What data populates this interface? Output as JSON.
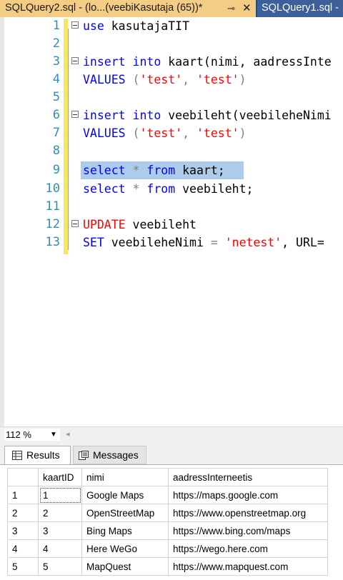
{
  "tabs": {
    "active_label": "SQLQuery2.sql - (lo...(veebiKasutaja (65))*",
    "inactive_label": "SQLQuery1.sql -"
  },
  "editor": {
    "lines": [
      {
        "n": "1",
        "fold": true
      },
      {
        "n": "2",
        "fold": false
      },
      {
        "n": "3",
        "fold": true
      },
      {
        "n": "4",
        "fold": false
      },
      {
        "n": "5",
        "fold": false
      },
      {
        "n": "6",
        "fold": true
      },
      {
        "n": "7",
        "fold": false
      },
      {
        "n": "8",
        "fold": false
      },
      {
        "n": "9",
        "fold": false
      },
      {
        "n": "10",
        "fold": false
      },
      {
        "n": "11",
        "fold": false
      },
      {
        "n": "12",
        "fold": true
      },
      {
        "n": "13",
        "fold": false
      }
    ],
    "code": {
      "l1_kw": "use",
      "l1_rest": " kasutajaTIT",
      "l3_kw1": "insert",
      "l3_kw2": "into",
      "l3_rest": " kaart(nimi, aadressInte",
      "l4_kw": "VALUES",
      "l4_p1": " (",
      "l4_s1": "'test'",
      "l4_c": ", ",
      "l4_s2": "'test'",
      "l4_p2": ")",
      "l6_kw1": "insert",
      "l6_kw2": "into",
      "l6_rest": " veebileht(veebileheNimi",
      "l7_kw": "VALUES",
      "l7_p1": " (",
      "l7_s1": "'test'",
      "l7_c": ", ",
      "l7_s2": "'test'",
      "l7_p2": ")",
      "l9_kw1": "select",
      "l9_star": " * ",
      "l9_kw2": "from",
      "l9_rest": " kaart;",
      "l10_kw1": "select",
      "l10_star": " * ",
      "l10_kw2": "from",
      "l10_rest": " veebileht;",
      "l12_kw": "UPDATE",
      "l12_rest": " veebileht",
      "l13_kw": "SET",
      "l13_rest": " veebileheNimi ",
      "l13_eq": "=",
      "l13_str": " 'netest'",
      "l13_tail": ", URL="
    }
  },
  "zoom": {
    "value": "112 %"
  },
  "results": {
    "tab_results": "Results",
    "tab_messages": "Messages",
    "columns": [
      "",
      "kaartID",
      "nimi",
      "aadressInterneetis"
    ],
    "rows": [
      [
        "1",
        "1",
        "Google Maps",
        "https://maps.google.com"
      ],
      [
        "2",
        "2",
        "OpenStreetMap",
        "https://www.openstreetmap.org"
      ],
      [
        "3",
        "3",
        "Bing Maps",
        "https://www.bing.com/maps"
      ],
      [
        "4",
        "4",
        "Here WeGo",
        "https://wego.here.com"
      ],
      [
        "5",
        "5",
        "MapQuest",
        "https://www.mapquest.com"
      ]
    ]
  },
  "colors": {
    "tabbar": "#2b4d7e",
    "active_tab": "#f5cc84",
    "keyword": "#0000ff",
    "string": "#ff0000",
    "line_number": "#2b91af",
    "selection": "#adcceb",
    "change_marker": "#f5e663"
  }
}
